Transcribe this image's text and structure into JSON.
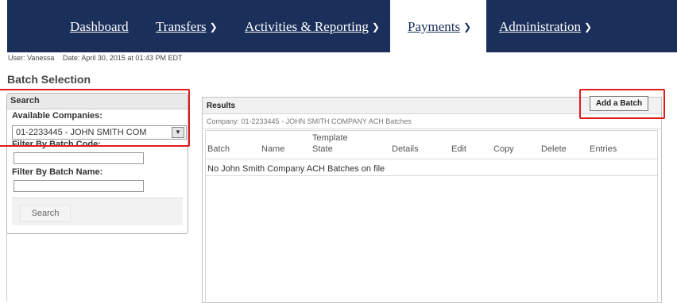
{
  "nav": {
    "items": [
      {
        "label": "Dashboard"
      },
      {
        "label": "Transfers",
        "chevron": "chevron-down-icon"
      },
      {
        "label": "Activities & Reporting",
        "chevron": "chevron-down-icon"
      },
      {
        "label": "Payments",
        "chevron": "chevron-down-icon",
        "active": true
      },
      {
        "label": "Administration",
        "chevron": "chevron-down-icon"
      }
    ],
    "bg_color": "#1b2f5b"
  },
  "user_line": {
    "user": "User: Vanessa",
    "date": "Date: April 30, 2015 at 01:43 PM EDT"
  },
  "page_title": "Batch Selection",
  "search_panel": {
    "title": "Search",
    "companies_label": "Available Companies:",
    "company_selected": "01-2233445 - JOHN SMITH COM",
    "batch_code_label": "Filter By Batch Code:",
    "batch_code_value": "",
    "batch_name_label": "Filter By Batch Name:",
    "batch_name_value": "",
    "search_button": "Search"
  },
  "results": {
    "title": "Results",
    "company_line": "Company: 01-2233445 - JOHN SMITH COMPANY ACH Batches",
    "add_button": "Add a Batch",
    "columns": [
      "Batch",
      "Name",
      "Template",
      "State",
      "Details",
      "Edit",
      "Copy",
      "Delete",
      "Entries"
    ],
    "empty_message": "No John Smith Company ACH Batches on file"
  },
  "highlight_color": "#e01b1b"
}
